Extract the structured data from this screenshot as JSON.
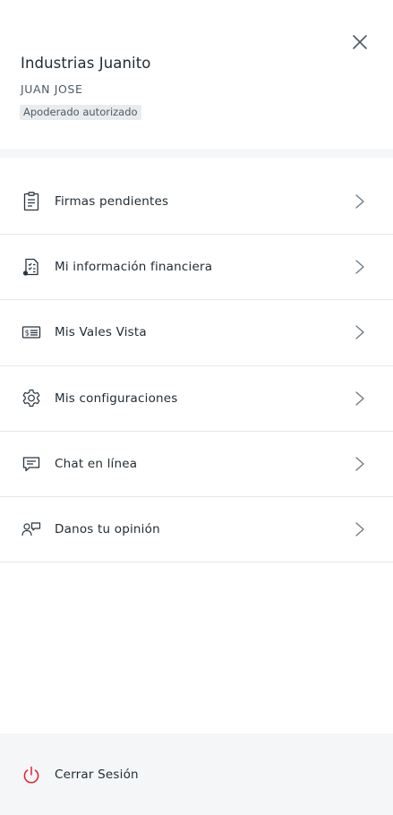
{
  "header": {
    "company": "Industrias Juanito",
    "user_name": "JUAN JOSE",
    "role": "Apoderado autorizado",
    "close_icon": "close-icon"
  },
  "menu": {
    "items": [
      {
        "label": "Firmas pendientes",
        "icon": "clipboard-icon"
      },
      {
        "label": "Mi información financiera",
        "icon": "financial-document-icon"
      },
      {
        "label": "Mis Vales Vista",
        "icon": "bill-icon"
      },
      {
        "label": "Mis configuraciones",
        "icon": "gear-icon"
      },
      {
        "label": "Chat en línea",
        "icon": "chat-icon"
      },
      {
        "label": "Danos tu opinión",
        "icon": "feedback-icon"
      }
    ]
  },
  "footer": {
    "logout_label": "Cerrar Sesión",
    "logout_icon": "power-icon"
  },
  "colors": {
    "text": "#1f2a33",
    "muted": "#4c5a66",
    "badge_bg": "#e9ecee",
    "divider": "#e4e7ea",
    "band_bg": "#f5f6f7",
    "power_red": "#e0202c"
  }
}
